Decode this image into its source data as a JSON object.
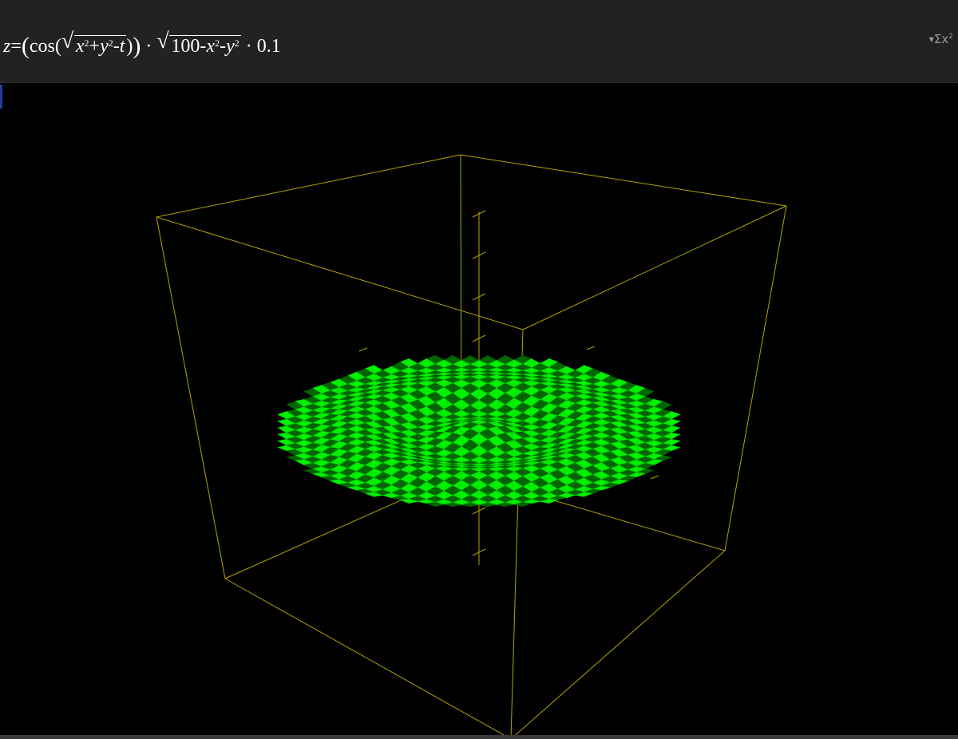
{
  "header": {
    "formula": {
      "lhs": "z",
      "cos": "cos",
      "x": "x",
      "y": "y",
      "t": "t",
      "hundred": "100",
      "scale": "0.1",
      "exp": "2"
    },
    "tool_button": {
      "label": "Σx",
      "exp": "2",
      "icon": "formula-editor-icon"
    }
  },
  "plot": {
    "surface_colors": [
      "#00ee00",
      "#006600"
    ],
    "axis_color": "#b3a300",
    "background": "#000000"
  }
}
